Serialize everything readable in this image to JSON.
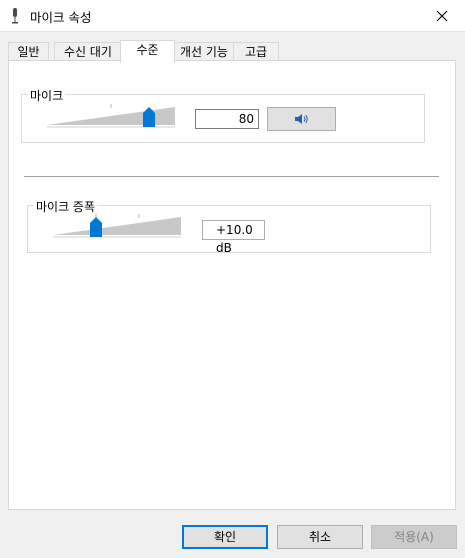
{
  "window": {
    "title": "마이크 속성"
  },
  "tabs": [
    {
      "label": "일반"
    },
    {
      "label": "수신 대기"
    },
    {
      "label": "수준"
    },
    {
      "label": "개선 기능"
    },
    {
      "label": "고급"
    }
  ],
  "active_tab": "수준",
  "microphone": {
    "label": "마이크",
    "value": "80",
    "level": 0.8
  },
  "boost": {
    "label": "마이크 증폭",
    "value": "+10.0 dB",
    "level": 0.333
  },
  "buttons": {
    "ok": "확인",
    "cancel": "취소",
    "apply": "적용(A)"
  },
  "colors": {
    "accent": "#0078d7",
    "track": "#c8c8c8"
  }
}
